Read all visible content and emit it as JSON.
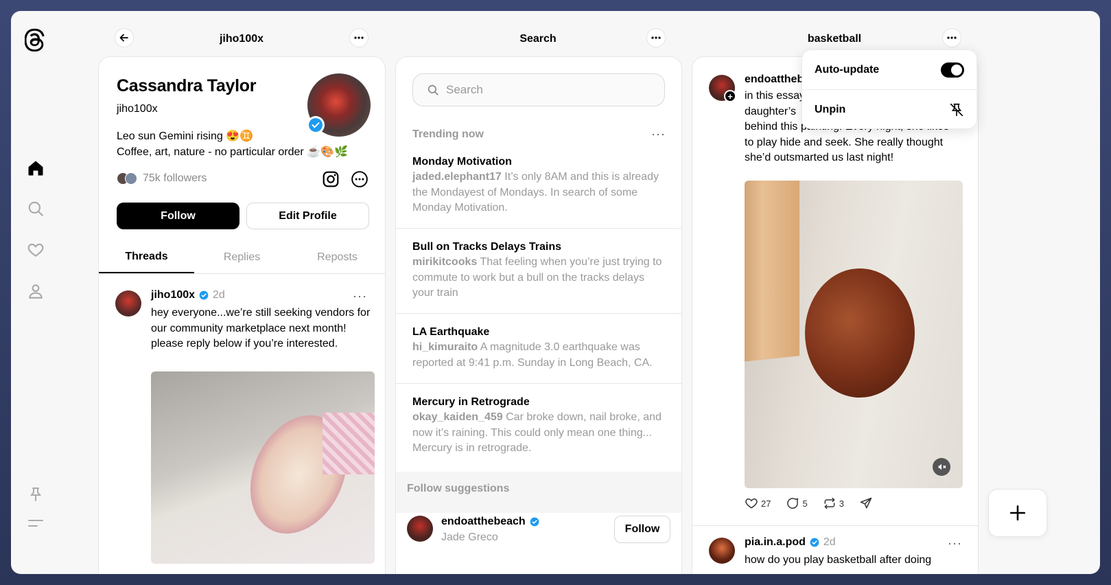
{
  "columns": {
    "profile": {
      "title": "jiho100x"
    },
    "search": {
      "title": "Search"
    },
    "feed": {
      "title": "basketball"
    }
  },
  "profile": {
    "name": "Cassandra Taylor",
    "handle": "jiho100x",
    "bio_line1": "Leo sun Gemini rising 😍♊",
    "bio_line2": "Coffee, art, nature - no particular order ☕🎨🌿",
    "followers": "75k followers",
    "follow_label": "Follow",
    "edit_label": "Edit Profile",
    "tabs": [
      "Threads",
      "Replies",
      "Reposts"
    ],
    "post": {
      "user": "jiho100x",
      "time": "2d",
      "text": "hey everyone...we’re still seeking vendors for our community marketplace next month! please reply below if you’re interested."
    }
  },
  "search": {
    "placeholder": "Search",
    "trending_label": "Trending now",
    "trends": [
      {
        "title": "Monday Motivation",
        "user": "jaded.elephant17",
        "text": "It’s only 8AM and this is already the Mondayest of Mondays. In search of some Monday Motivation."
      },
      {
        "title": "Bull on Tracks Delays Trains",
        "user": "mirikitcooks",
        "text": "That feeling when you’re just trying to commute to work but a bull on the tracks delays your train"
      },
      {
        "title": "LA Earthquake",
        "user": "hi_kimuraito",
        "text": "A magnitude 3.0 earthquake was reported at 9:41 p.m. Sunday in Long Beach, CA."
      },
      {
        "title": "Mercury in Retrograde",
        "user": "okay_kaiden_459",
        "text": "Car broke down, nail broke, and now it’s raining. This could only mean one thing... Mercury is in retrograde."
      }
    ],
    "suggestions_label": "Follow suggestions",
    "suggestion": {
      "user": "endoatthebeach",
      "name": "Jade Greco",
      "follow_label": "Follow"
    }
  },
  "feed": {
    "post1": {
      "user": "endoattheb",
      "line1": "in this essay",
      "line2": "daughter’s",
      "line3": "behind this painting. Every night, she likes",
      "line4": "to play hide and seek. She really thought",
      "line5": "she’d outsmarted us last night!",
      "likes": "27",
      "comments": "5",
      "reposts": "3"
    },
    "post2": {
      "user": "pia.in.a.pod",
      "time": "2d",
      "text": "how do you play basketball after doing"
    }
  },
  "menu": {
    "auto_update": "Auto-update",
    "unpin": "Unpin"
  }
}
